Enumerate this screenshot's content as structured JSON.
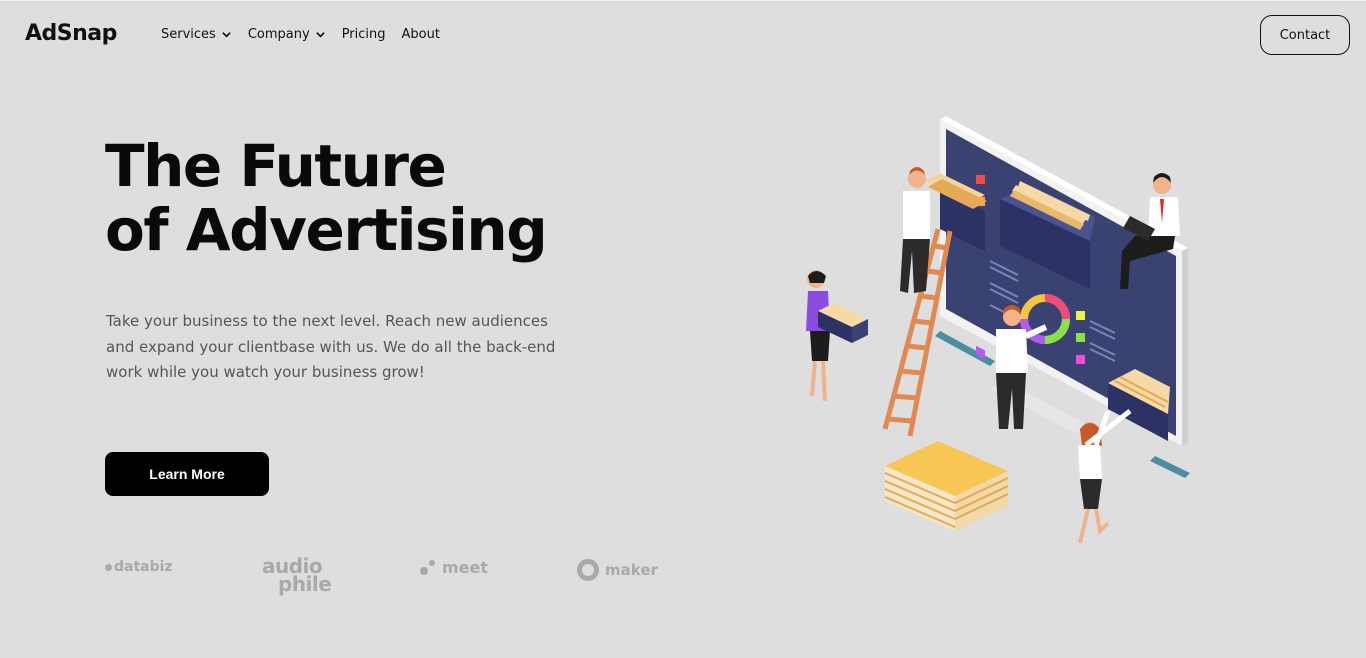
{
  "nav": {
    "logo": "AdSnap",
    "links": [
      {
        "label": "Services",
        "has_dropdown": true
      },
      {
        "label": "Company",
        "has_dropdown": true
      },
      {
        "label": "Pricing",
        "has_dropdown": false
      },
      {
        "label": "About",
        "has_dropdown": false
      }
    ],
    "contact_label": "Contact"
  },
  "hero": {
    "title_line1": "The Future",
    "title_line2": "of Advertising",
    "description": "Take your business to the next level. Reach new audiences and expand your clientbase with us. We do all the back-end work while you watch your business grow!",
    "cta_label": "Learn More"
  },
  "brands": {
    "databiz": "databiz",
    "audiophile_line1": "audio",
    "audiophile_line2": "phile",
    "meet": "meet",
    "maker": "maker"
  },
  "colors": {
    "background": "#dedede",
    "text_dark": "#0a0a0a",
    "text_muted": "#555555",
    "brand_gray": "#a9a9a9",
    "button_bg": "#000000",
    "screen_navy": "#3a4272",
    "folder_yellow": "#f7c654",
    "ladder_orange": "#e08a52"
  }
}
